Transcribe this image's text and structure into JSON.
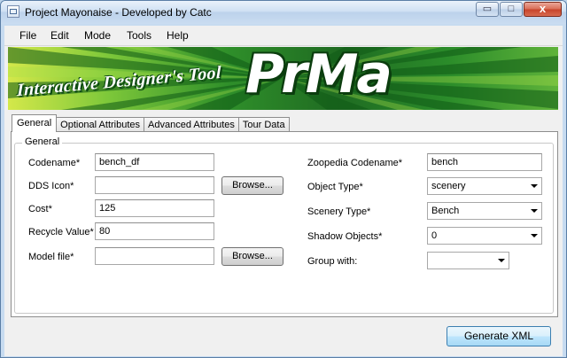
{
  "window": {
    "title": "Project Mayonaise - Developed by Catc"
  },
  "title_buttons": {
    "minimize": "▭",
    "maximize": "□",
    "close": "x"
  },
  "menu": {
    "items": [
      "File",
      "Edit",
      "Mode",
      "Tools",
      "Help"
    ]
  },
  "banner": {
    "subtitle": "Interactive Designer's Tool",
    "logo": "PrMa"
  },
  "tabs": [
    "General",
    "Optional Attributes",
    "Advanced Attributes",
    "Tour Data"
  ],
  "active_tab": "General",
  "group": {
    "title": "General"
  },
  "fields": {
    "codename": {
      "label": "Codename*",
      "value": "bench_df"
    },
    "dds_icon": {
      "label": "DDS Icon*",
      "value": ""
    },
    "cost": {
      "label": "Cost*",
      "value": "125"
    },
    "recycle_value": {
      "label": "Recycle Value*",
      "value": "80"
    },
    "model_file": {
      "label": "Model file*",
      "value": ""
    },
    "zoopedia_codename": {
      "label": "Zoopedia Codename*",
      "value": "bench"
    },
    "object_type": {
      "label": "Object Type*",
      "value": "scenery"
    },
    "scenery_type": {
      "label": "Scenery Type*",
      "value": "Bench"
    },
    "shadow_objects": {
      "label": "Shadow Objects*",
      "value": "0"
    },
    "group_with": {
      "label": "Group with:",
      "value": ""
    }
  },
  "buttons": {
    "browse": "Browse...",
    "generate": "Generate XML"
  }
}
